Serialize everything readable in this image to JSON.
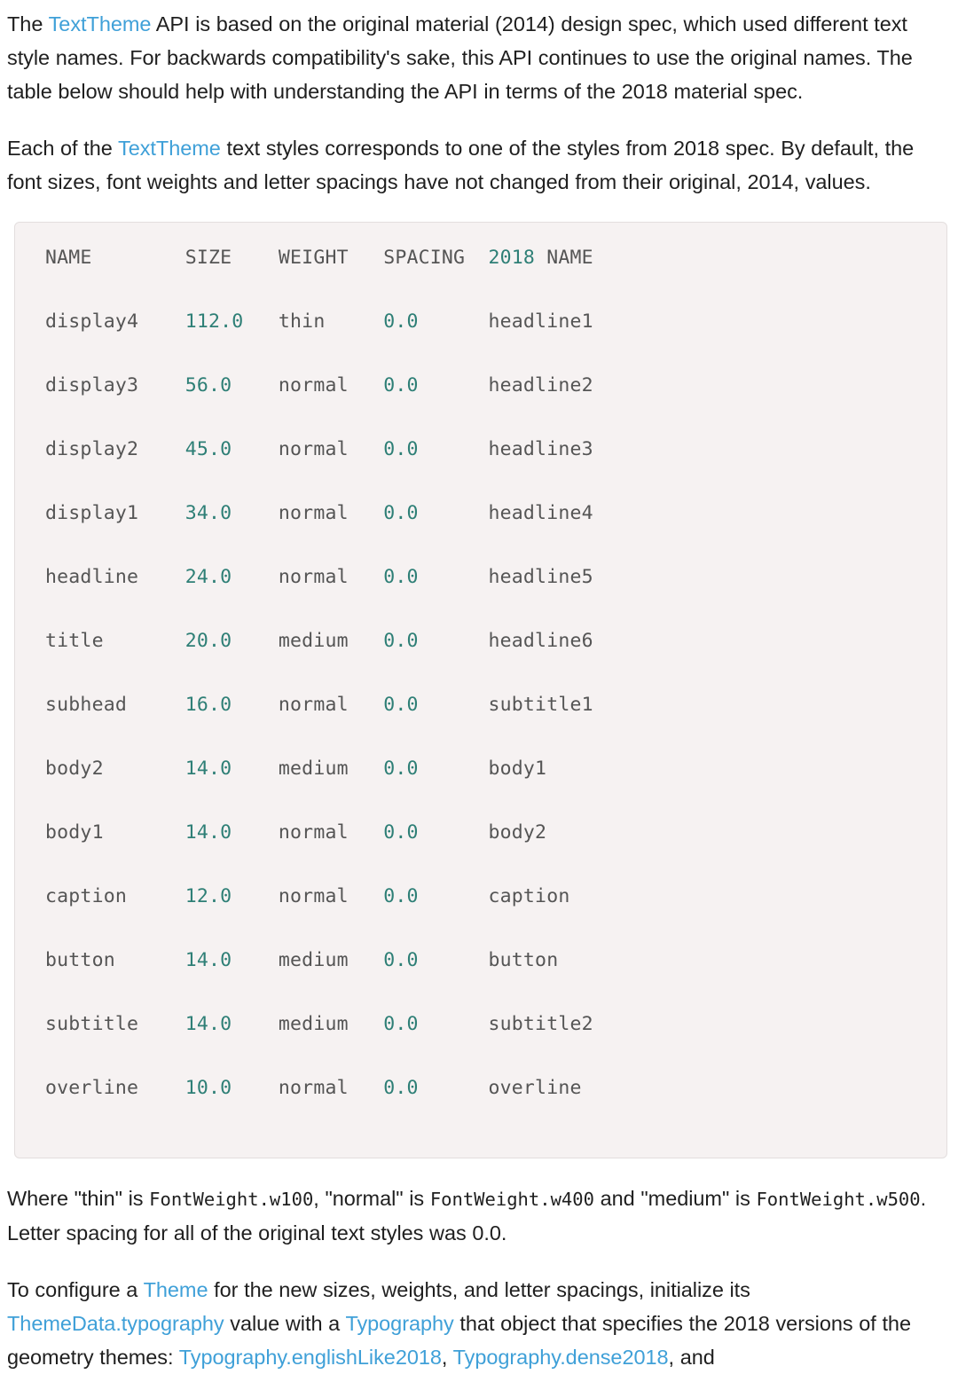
{
  "paragraphs": {
    "p1": {
      "before_link": "The ",
      "link": "TextTheme",
      "after_link": " API is based on the original material (2014) design spec, which used different text style names. For backwards compatibility's sake, this API continues to use the original names. The table below should help with understanding the API in terms of the 2018 material spec."
    },
    "p2": {
      "before_link": "Each of the ",
      "link": "TextTheme",
      "after_link": " text styles corresponds to one of the styles from 2018 spec. By default, the font sizes, font weights and letter spacings have not changed from their original, 2014, values."
    },
    "p3": {
      "seg1": "Where \"thin\" is ",
      "code1": "FontWeight.w100",
      "seg2": ", \"normal\" is ",
      "code2": "FontWeight.w400",
      "seg3": " and \"medium\" is ",
      "code3": "FontWeight.w500",
      "seg4": ". Letter spacing for all of the original text styles was 0.0."
    },
    "p4": {
      "seg1": "To configure a ",
      "link1": "Theme",
      "seg2": " for the new sizes, weights, and letter spacings, initialize its ",
      "link2": "ThemeData.typography",
      "seg3": " value with a ",
      "link3": "Typography",
      "seg4": " that object that specifies the 2018 versions of the geometry themes: ",
      "link4": "Typography.englishLike2018",
      "seg5": ", ",
      "link5": "Typography.dense2018",
      "seg6": ", and"
    }
  },
  "code_table": {
    "headers": {
      "name": "NAME",
      "size": "SIZE",
      "weight": "WEIGHT",
      "spacing": "SPACING",
      "year": "2018",
      "name2018": "NAME"
    },
    "rows": [
      {
        "name": "display4",
        "size": "112.0",
        "weight": "thin",
        "spacing": "0.0",
        "name2018": "headline1"
      },
      {
        "name": "display3",
        "size": "56.0",
        "weight": "normal",
        "spacing": "0.0",
        "name2018": "headline2"
      },
      {
        "name": "display2",
        "size": "45.0",
        "weight": "normal",
        "spacing": "0.0",
        "name2018": "headline3"
      },
      {
        "name": "display1",
        "size": "34.0",
        "weight": "normal",
        "spacing": "0.0",
        "name2018": "headline4"
      },
      {
        "name": "headline",
        "size": "24.0",
        "weight": "normal",
        "spacing": "0.0",
        "name2018": "headline5"
      },
      {
        "name": "title",
        "size": "20.0",
        "weight": "medium",
        "spacing": "0.0",
        "name2018": "headline6"
      },
      {
        "name": "subhead",
        "size": "16.0",
        "weight": "normal",
        "spacing": "0.0",
        "name2018": "subtitle1"
      },
      {
        "name": "body2",
        "size": "14.0",
        "weight": "medium",
        "spacing": "0.0",
        "name2018": "body1"
      },
      {
        "name": "body1",
        "size": "14.0",
        "weight": "normal",
        "spacing": "0.0",
        "name2018": "body2"
      },
      {
        "name": "caption",
        "size": "12.0",
        "weight": "normal",
        "spacing": "0.0",
        "name2018": "caption"
      },
      {
        "name": "button",
        "size": "14.0",
        "weight": "medium",
        "spacing": "0.0",
        "name2018": "button"
      },
      {
        "name": "subtitle",
        "size": "14.0",
        "weight": "medium",
        "spacing": "0.0",
        "name2018": "subtitle2"
      },
      {
        "name": "overline",
        "size": "10.0",
        "weight": "normal",
        "spacing": "0.0",
        "name2018": "overline"
      }
    ],
    "columns": {
      "name": 12,
      "size": 8,
      "weight": 9,
      "spacing": 9,
      "name2018": 10
    }
  },
  "colors": {
    "link": "#3fa0d8",
    "code_number": "#2e7f76",
    "code_text": "#555555",
    "code_background": "#f6f2f2",
    "code_border": "#e3dede",
    "body_text": "#1f1f1f"
  }
}
